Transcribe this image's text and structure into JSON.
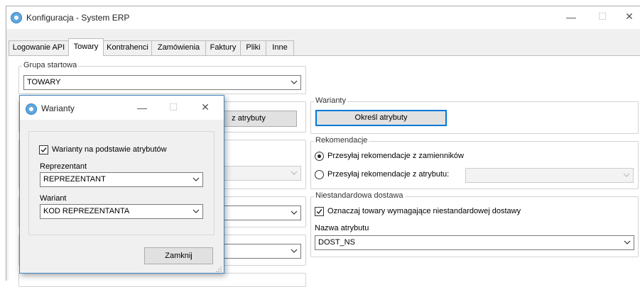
{
  "window": {
    "title": "Konfiguracja - System ERP",
    "minimize": "—",
    "maximize": "☐",
    "close": "✕"
  },
  "tabs": [
    "Logowanie API",
    "Towary",
    "Kontrahenci",
    "Zamówienia",
    "Faktury",
    "Pliki",
    "Inne"
  ],
  "grupa_startowa": {
    "label": "Grupa startowa",
    "value": "TOWARY"
  },
  "behind": {
    "button_partial": "z atrybuty"
  },
  "warianty": {
    "label": "Warianty",
    "button": "Określ atrybuty"
  },
  "rekomendacje": {
    "label": "Rekomendacje",
    "option1": "Przesyłaj rekomendacje z zamienników",
    "option2": "Przesyłaj rekomendacje z atrybutu:",
    "combo_value": ""
  },
  "niestandardowa": {
    "label": "Niestandardowa dostawa",
    "checkbox": "Oznaczaj towary wymagające niestandardowej dostawy",
    "attr_label": "Nazwa atrybutu",
    "attr_value": "DOST_NS"
  },
  "dialog": {
    "title": "Warianty",
    "minimize": "—",
    "maximize": "☐",
    "close": "✕",
    "checkbox": "Warianty na podstawie atrybutów",
    "reprezentant_label": "Reprezentant",
    "reprezentant_value": "REPREZENTANT",
    "wariant_label": "Wariant",
    "wariant_value": "KOD REPREZENTANTA",
    "close_button": "Zamknij"
  },
  "colors": {
    "accent": "#0078d7",
    "dialog_border": "#3d86c6",
    "window_bg": "#f0f0f0"
  },
  "icons": [
    "app-icon",
    "chevron-down-icon",
    "checkmark-icon",
    "resize-grip-icon"
  ]
}
